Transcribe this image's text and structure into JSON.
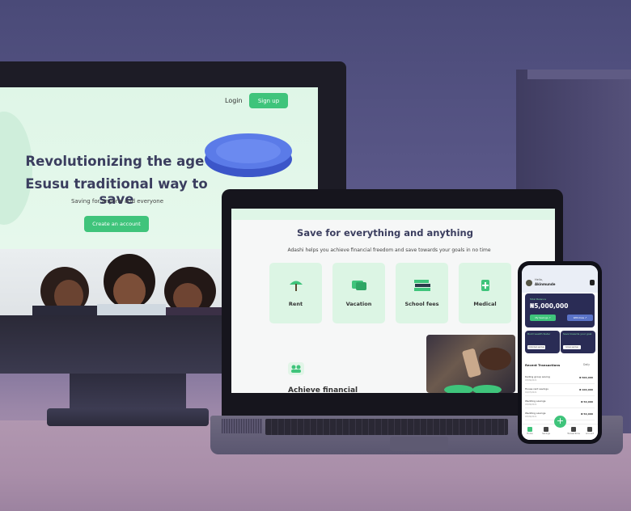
{
  "desktop_site": {
    "login_label": "Login",
    "signup_label": "Sign up",
    "headline_line1": "Revolutionizing the age long",
    "headline_line2": "Esusu traditional way to save",
    "subtitle": "Saving for anyone and everyone",
    "cta_label": "Create an account"
  },
  "laptop_site": {
    "title": "Save for everything and anything",
    "subtitle": "Adashi helps you achieve financial freedom and save towards your goals in no time",
    "cards": [
      {
        "label": "Rent",
        "icon": "umbrella-icon"
      },
      {
        "label": "Vacation",
        "icon": "money-icon"
      },
      {
        "label": "School fees",
        "icon": "books-icon"
      },
      {
        "label": "Medical",
        "icon": "medical-icon"
      }
    ],
    "partial_heading": "Achieve financial"
  },
  "phone_app": {
    "greeting": "Hello,",
    "user_name": "Akinmunde",
    "balance_label": "Total Balance",
    "balance_value": "₦5,000,000",
    "btn_savings": "My Savings ↗",
    "btn_withdraw": "Withdraw ↗",
    "mini_cards": [
      {
        "title": "Build wealth faster",
        "button": "Individual savings"
      },
      {
        "title": "Save towards your goal",
        "button": "Group savings"
      }
    ],
    "recent_title": "Recent Transactions",
    "filter": "Daily",
    "transactions": [
      {
        "name": "Kading group saving",
        "date": "03/09/2021",
        "amount": "₦ 500,000"
      },
      {
        "name": "House rent savings",
        "date": "01/07/2021",
        "amount": "₦ 100,000"
      },
      {
        "name": "Wedding savings",
        "date": "03/09/2021",
        "amount": "₦ 50,000"
      },
      {
        "name": "Wedding savings",
        "date": "03/09/2021",
        "amount": "₦ 50,000"
      }
    ],
    "nav": [
      "Home",
      "Savings",
      "Transactions",
      "Account"
    ]
  },
  "colors": {
    "brand_green": "#3fc47b",
    "navy": "#2a2c55",
    "headline": "#3b3e5f",
    "background": "#5b5a86"
  }
}
